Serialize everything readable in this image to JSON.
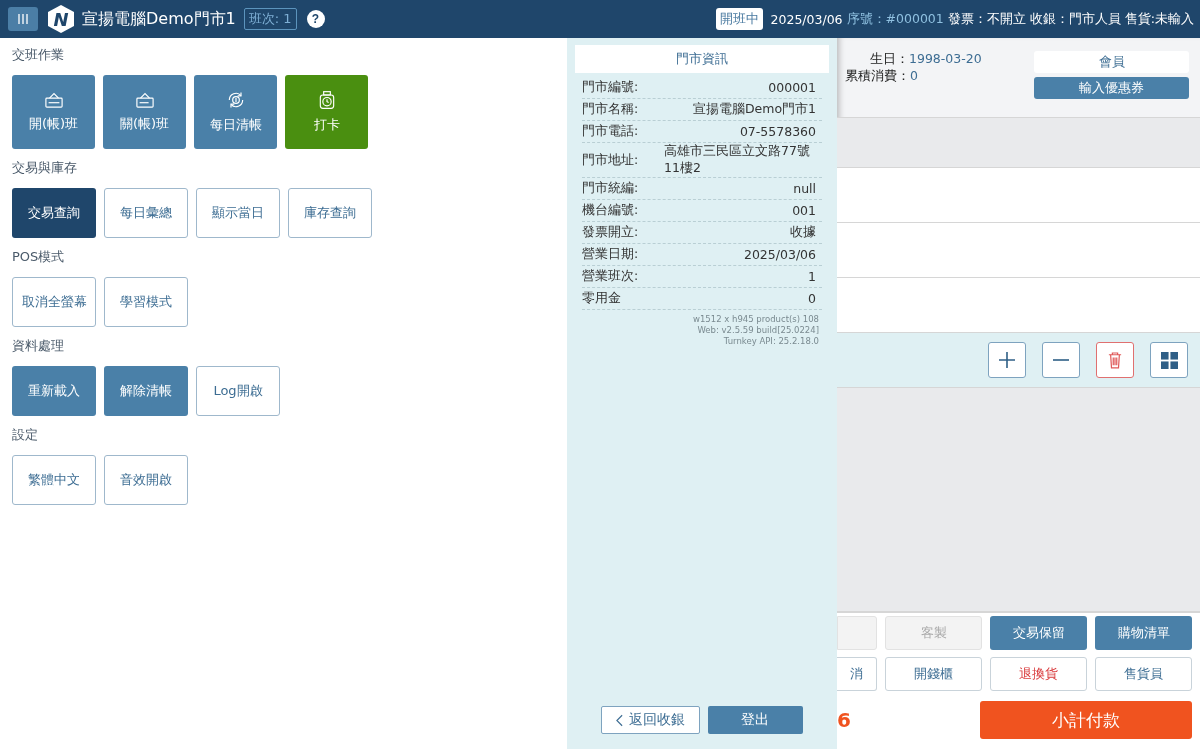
{
  "top_bar": {
    "logo": "N",
    "store_name": "宣揚電腦Demo門市1",
    "shift": "班次: 1",
    "help": "?",
    "status": "開班中",
    "date": "2025/03/06",
    "serial": "序號：#000001",
    "invoice": "發票：不開立",
    "cashier": "收銀：門市人員",
    "seller": "售貨:未輸入"
  },
  "menu": [
    {
      "title": "交班作業",
      "kind": "icon-buttons",
      "buttons": [
        {
          "label": "開(帳)班",
          "kind": "primary"
        },
        {
          "label": "關(帳)班",
          "kind": "primary"
        },
        {
          "label": "每日清帳",
          "kind": "primary"
        },
        {
          "label": "打卡",
          "kind": "success"
        }
      ]
    },
    {
      "title": "交易與庫存",
      "kind": "text-buttons",
      "buttons": [
        {
          "label": "交易查詢",
          "kind": "dark"
        },
        {
          "label": "每日彙總",
          "kind": "outline"
        },
        {
          "label": "顯示當日",
          "kind": "outline"
        },
        {
          "label": "庫存查詢",
          "kind": "outline"
        }
      ]
    },
    {
      "title": "POS模式",
      "kind": "text-buttons",
      "buttons": [
        {
          "label": "取消全螢幕",
          "kind": "outline"
        },
        {
          "label": "學習模式",
          "kind": "outline"
        }
      ]
    },
    {
      "title": "資料處理",
      "kind": "text-buttons",
      "buttons": [
        {
          "label": "重新載入",
          "kind": "primary"
        },
        {
          "label": "解除清帳",
          "kind": "primary"
        },
        {
          "label": "Log開啟",
          "kind": "outline"
        }
      ]
    },
    {
      "title": "設定",
      "kind": "text-buttons",
      "buttons": [
        {
          "label": "繁體中文",
          "kind": "outline"
        },
        {
          "label": "音效開啟",
          "kind": "outline"
        }
      ]
    }
  ],
  "store_info": {
    "title": "門市資訊",
    "rows": [
      {
        "label": "門市編號:",
        "value": "000001"
      },
      {
        "label": "門市名稱:",
        "value": "宣揚電腦Demo門市1"
      },
      {
        "label": "門市電話:",
        "value": "07-5578360"
      },
      {
        "label": "門市地址:",
        "value": "高雄市三民區立文路77號11樓2"
      },
      {
        "label": "門市統編:",
        "value": "null"
      },
      {
        "label": "機台編號:",
        "value": "001"
      },
      {
        "label": "發票開立:",
        "value": "收據"
      },
      {
        "label": "營業日期:",
        "value": "2025/03/06"
      },
      {
        "label": "營業班次:",
        "value": "1"
      },
      {
        "label": "零用金",
        "value": "0"
      }
    ],
    "footer": [
      "w1512 x h945 product(s) 108",
      "Web: v2.5.59 build[25.0224]",
      "Turnkey API: 25.2.18.0"
    ],
    "buttons": [
      {
        "label": "返回收銀",
        "kind": "back"
      },
      {
        "label": "登出",
        "kind": "primary"
      }
    ]
  },
  "pos": {
    "member": {
      "birthday_label": "生日：",
      "birthday": "1998-03-20",
      "spend_label": "累積消費：",
      "spend": "0",
      "buttons": [
        {
          "label": "會員",
          "kind": "light"
        },
        {
          "label": "輸入優惠券",
          "kind": "primary"
        }
      ]
    },
    "tools": [
      {
        "kind": "plus"
      },
      {
        "kind": "minus"
      },
      {
        "kind": "trash"
      },
      {
        "kind": "grid"
      }
    ],
    "actions": [
      [
        {
          "kind": "disabled"
        },
        {
          "label": "客製",
          "kind": "disabled"
        },
        {
          "label": "交易保留",
          "kind": "primary"
        },
        {
          "label": "購物清單",
          "kind": "primary"
        }
      ],
      [
        {
          "label": "消",
          "kind": "outline"
        },
        {
          "label": "開錢櫃",
          "kind": "outline"
        },
        {
          "label": "退換貨",
          "kind": "danger"
        },
        {
          "label": "售貨員",
          "kind": "outline"
        }
      ]
    ],
    "total": "6",
    "checkout": "小計付款"
  }
}
